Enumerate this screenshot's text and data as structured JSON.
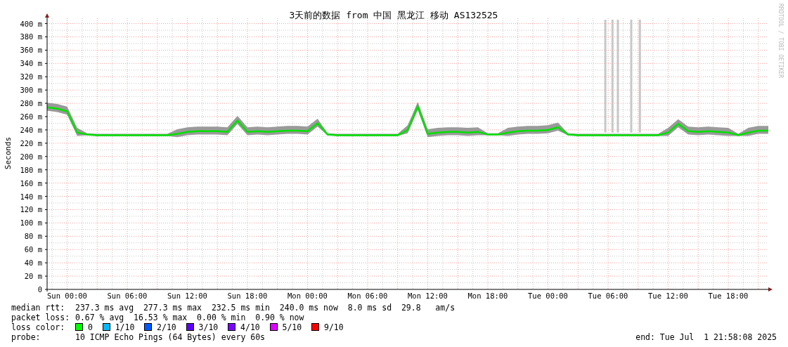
{
  "chart": {
    "chart_data": {
      "type": "line",
      "title": "3天前的数据 from 中国 黑龙江 移动 AS132525",
      "ylabel": "Seconds",
      "ylim": [
        0,
        408
      ],
      "grid": true,
      "categories": [
        null,
        null,
        "Sun 00:00",
        null,
        null,
        null,
        null,
        null,
        "Sun 06:00",
        null,
        null,
        null,
        null,
        null,
        "Sun 12:00",
        null,
        null,
        null,
        null,
        null,
        "Sun 18:00",
        null,
        null,
        null,
        null,
        null,
        "Mon 00:00",
        null,
        null,
        null,
        null,
        null,
        "Mon 06:00",
        null,
        null,
        null,
        null,
        null,
        "Mon 12:00",
        null,
        null,
        null,
        null,
        null,
        "Mon 18:00",
        null,
        null,
        null,
        null,
        null,
        "Tue 00:00",
        null,
        null,
        null,
        null,
        null,
        "Tue 06:00",
        null,
        null,
        null,
        null,
        null,
        "Tue 12:00",
        null,
        null,
        null,
        null,
        null,
        "Tue 18:00",
        null,
        null,
        null,
        null
      ],
      "series": [
        {
          "color": "#00e000",
          "values": [
            274,
            272,
            268,
            236,
            233,
            232,
            232,
            232,
            232,
            232,
            232,
            232,
            232,
            234,
            237,
            238,
            238,
            238,
            237,
            254,
            237,
            238,
            237,
            238,
            239,
            239,
            238,
            250,
            233,
            232,
            232,
            232,
            232,
            232,
            232,
            232,
            240,
            275,
            234,
            236,
            237,
            237,
            236,
            237,
            233,
            233,
            236,
            238,
            239,
            239,
            240,
            244,
            233,
            232,
            232,
            232,
            232,
            232,
            232,
            232,
            232,
            232,
            236,
            249,
            238,
            237,
            238,
            237,
            236,
            232,
            236,
            239,
            239
          ]
        }
      ],
      "yticks": [
        {
          "value": 0,
          "label": "0"
        },
        {
          "value": 20,
          "label": "20 m"
        },
        {
          "value": 40,
          "label": "40 m"
        },
        {
          "value": 60,
          "label": "60 m"
        },
        {
          "value": 80,
          "label": "80 m"
        },
        {
          "value": 100,
          "label": "100 m"
        },
        {
          "value": 120,
          "label": "120 m"
        },
        {
          "value": 140,
          "label": "140 m"
        },
        {
          "value": 160,
          "label": "160 m"
        },
        {
          "value": 180,
          "label": "180 m"
        },
        {
          "value": 200,
          "label": "200 m"
        },
        {
          "value": 220,
          "label": "220 m"
        },
        {
          "value": 240,
          "label": "240 m"
        },
        {
          "value": 260,
          "label": "260 m"
        },
        {
          "value": 280,
          "label": "280 m"
        },
        {
          "value": 300,
          "label": "300 m"
        },
        {
          "value": 320,
          "label": "320 m"
        },
        {
          "value": 340,
          "label": "340 m"
        },
        {
          "value": 360,
          "label": "360 m"
        },
        {
          "value": 380,
          "label": "380 m"
        },
        {
          "value": 400,
          "label": "400 m"
        }
      ]
    }
  },
  "credit": "RRDTOOL / TOBI OETIKER",
  "legend": [
    {
      "kind": "values",
      "label": "median rtt:",
      "values": [
        "237.3 ms avg",
        "277.3 ms max",
        "232.5 ms min",
        "240.0 ms now",
        "8.0 ms sd",
        "29.8   am/s"
      ]
    },
    {
      "kind": "values",
      "label": "packet loss:",
      "values": [
        "0.67 % avg",
        "16.53 % max",
        "0.00 % min",
        "0.90 % now"
      ]
    },
    {
      "kind": "swatches",
      "label": "loss color:",
      "items": [
        {
          "label": "0",
          "color": "#00ff00"
        },
        {
          "label": "1/10",
          "color": "#00b8ff"
        },
        {
          "label": "2/10",
          "color": "#0059ff"
        },
        {
          "label": "3/10",
          "color": "#5e00ff"
        },
        {
          "label": "4/10",
          "color": "#7e00ff"
        },
        {
          "label": "5/10",
          "color": "#dd00ff"
        },
        {
          "label": "9/10",
          "color": "#ff0000"
        }
      ]
    },
    {
      "kind": "text",
      "label": "probe:",
      "text": "10 ICMP Echo Pings (64 Bytes) every 60s"
    }
  ],
  "end": "end: Tue Jul  1 21:58:08 2025"
}
